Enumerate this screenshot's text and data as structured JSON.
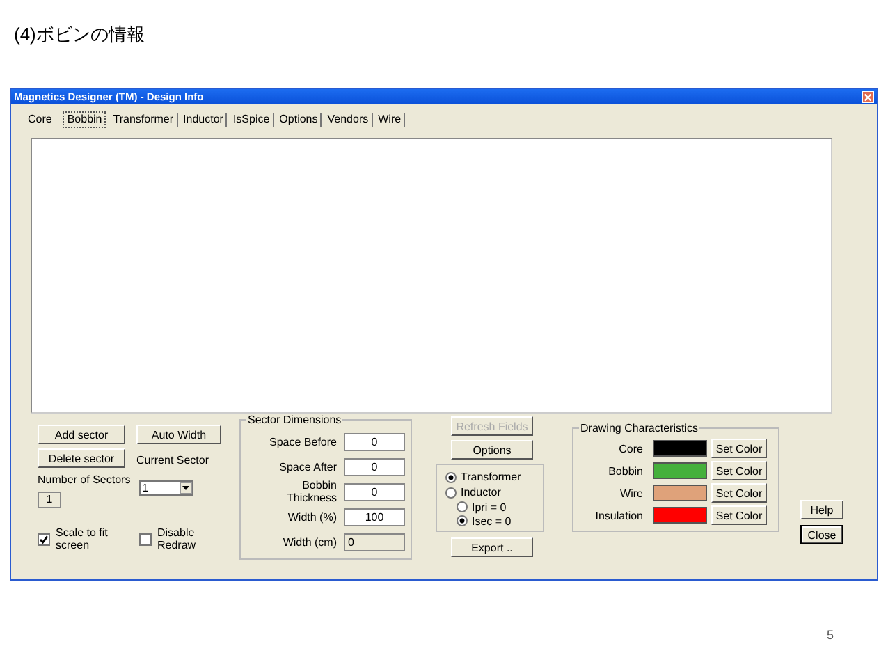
{
  "slide": {
    "title": "(4)ボビンの情報",
    "page_number": "5"
  },
  "window": {
    "title": "Magnetics Designer (TM) - Design Info"
  },
  "tabs": [
    {
      "label": "Core",
      "selected": false
    },
    {
      "label": "Bobbin",
      "selected": true
    },
    {
      "label": "Transformer",
      "selected": false
    },
    {
      "label": "Inductor",
      "selected": false
    },
    {
      "label": "IsSpice",
      "selected": false
    },
    {
      "label": "Options",
      "selected": false
    },
    {
      "label": "Vendors",
      "selected": false
    },
    {
      "label": "Wire",
      "selected": false
    }
  ],
  "sector_controls": {
    "add_button": "Add sector",
    "auto_width_button": "Auto Width",
    "delete_button": "Delete sector",
    "current_sector_label": "Current Sector",
    "current_sector_value": "1",
    "number_label": "Number of Sectors",
    "number_value": "1",
    "checkboxes": [
      {
        "label": "Scale to fit screen",
        "checked": true
      },
      {
        "label": "Disable Redraw",
        "checked": false
      }
    ]
  },
  "sector_dimensions": {
    "title": "Sector Dimensions",
    "fields": [
      {
        "label": "Space Before",
        "value": "0",
        "disabled": false
      },
      {
        "label": "Space After",
        "value": "0",
        "disabled": false
      },
      {
        "label": "Bobbin Thickness",
        "value": "0",
        "disabled": false
      },
      {
        "label": "Width (%)",
        "value": "100",
        "disabled": false
      },
      {
        "label": "Width (cm)",
        "value": "0",
        "disabled": true
      }
    ]
  },
  "middle_buttons": [
    {
      "label": "Refresh Fields",
      "disabled": true
    },
    {
      "label": "Options",
      "disabled": false
    }
  ],
  "mode_radios": [
    {
      "label": "Transformer",
      "selected": true
    },
    {
      "label": "Inductor",
      "selected": false
    }
  ],
  "zero_radios": [
    {
      "label": "Ipri = 0",
      "selected": false
    },
    {
      "label": "Isec = 0",
      "selected": true
    }
  ],
  "export_button": "Export ..",
  "drawing": {
    "title": "Drawing Characteristics",
    "rows": [
      {
        "label": "Core",
        "color": "#000000",
        "button": "Set Color"
      },
      {
        "label": "Bobbin",
        "color": "#45b03c",
        "button": "Set Color"
      },
      {
        "label": "Wire",
        "color": "#dfa27a",
        "button": "Set Color"
      },
      {
        "label": "Insulation",
        "color": "#ff0000",
        "button": "Set Color"
      }
    ]
  },
  "dialog_buttons": [
    {
      "label": "Help",
      "default": false
    },
    {
      "label": "Close",
      "default": true
    }
  ]
}
